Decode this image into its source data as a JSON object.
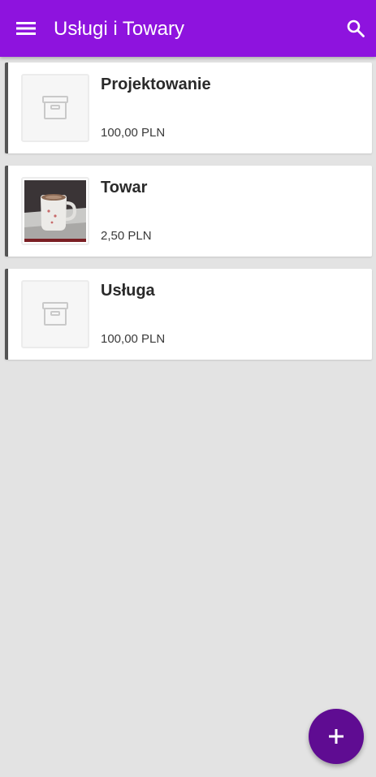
{
  "header": {
    "title": "Usługi i Towary",
    "menu_icon": "menu-icon",
    "search_icon": "search-icon",
    "color": "#8e13de"
  },
  "items": [
    {
      "name": "Projektowanie",
      "price": "100,00 PLN",
      "thumbnail": "archive-box-icon"
    },
    {
      "name": "Towar",
      "price": "2,50 PLN",
      "thumbnail": "coffee-mug-photo"
    },
    {
      "name": "Usługa",
      "price": "100,00 PLN",
      "thumbnail": "archive-box-icon"
    }
  ],
  "fab": {
    "icon": "plus-icon",
    "color": "#5f0c92"
  }
}
